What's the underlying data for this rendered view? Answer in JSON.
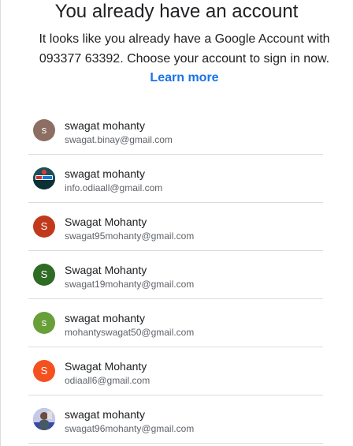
{
  "header": {
    "title": "You already have an account",
    "subtitle_text": "It looks like you already have a Google Account with 093377 63392. Choose your account to sign in now.",
    "learn_more": "Learn more"
  },
  "accounts": [
    {
      "name": "swagat mohanty",
      "email": "swagat.binay@gmail.com",
      "initial": "s",
      "color": "#8d6e63",
      "avatar": "letter"
    },
    {
      "name": "swagat mohanty",
      "email": "info.odiaall@gmail.com",
      "initial": "",
      "color": "#1b4f5a",
      "avatar": "photo-logo"
    },
    {
      "name": "Swagat Mohanty",
      "email": "swagat95mohanty@gmail.com",
      "initial": "S",
      "color": "#c1391b",
      "avatar": "letter"
    },
    {
      "name": "Swagat Mohanty",
      "email": "swagat19mohanty@gmail.com",
      "initial": "S",
      "color": "#2e6b24",
      "avatar": "letter"
    },
    {
      "name": "swagat mohanty",
      "email": "mohantyswagat50@gmail.com",
      "initial": "s",
      "color": "#689f38",
      "avatar": "letter"
    },
    {
      "name": "Swagat Mohanty",
      "email": "odiaall6@gmail.com",
      "initial": "S",
      "color": "#f4511e",
      "avatar": "letter"
    },
    {
      "name": "swagat mohanty",
      "email": "swagat96mohanty@gmail.com",
      "initial": "",
      "color": "#5c6bc0",
      "avatar": "photo-person"
    }
  ]
}
